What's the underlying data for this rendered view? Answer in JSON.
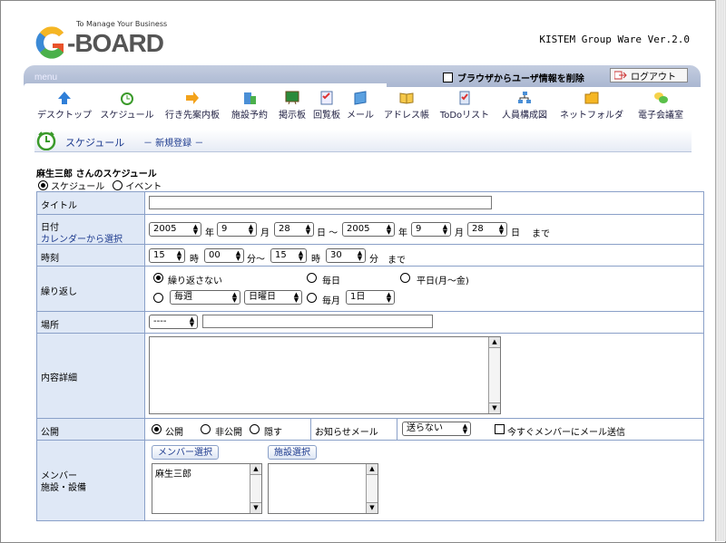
{
  "header": {
    "tagline": "To Manage Your Business",
    "logo_word": "BOARD",
    "version": "KISTEM Group Ware Ver.2.0"
  },
  "menu": {
    "label": "menu",
    "clear_browser_label": "ブラウザからユーザ情報を削除",
    "logout_label": "ログアウト",
    "items": [
      {
        "label": "デスクトップ",
        "icon": "arrow-up-icon"
      },
      {
        "label": "スケジュール",
        "icon": "clock-icon"
      },
      {
        "label": "行き先案内板",
        "icon": "arrow-right-icon"
      },
      {
        "label": "施設予約",
        "icon": "building-icon"
      },
      {
        "label": "掲示板",
        "icon": "board-icon"
      },
      {
        "label": "回覧板",
        "icon": "checklist-icon"
      },
      {
        "label": "メール",
        "icon": "mail-icon"
      },
      {
        "label": "アドレス帳",
        "icon": "book-icon"
      },
      {
        "label": "ToDoリスト",
        "icon": "todo-icon"
      },
      {
        "label": "人員構成図",
        "icon": "org-icon"
      },
      {
        "label": "ネットフォルダ",
        "icon": "folder-icon"
      },
      {
        "label": "電子会議室",
        "icon": "meeting-icon"
      }
    ]
  },
  "page": {
    "title": "スケジュール",
    "subtitle": "－ 新規登録 －",
    "owner": "麻生三郎 さんのスケジュール",
    "mode_schedule": "スケジュール",
    "mode_event": "イベント"
  },
  "form": {
    "title_label": "タイトル",
    "title_value": "",
    "date_label": "日付",
    "calendar_link": "カレンダーから選択",
    "start_year": "2005",
    "start_month": "9",
    "start_day": "28",
    "end_year": "2005",
    "end_month": "9",
    "end_day": "28",
    "unit_year": "年",
    "unit_month": "月",
    "unit_day": "日",
    "tilde": "日 ～",
    "until": "まで",
    "time_label": "時刻",
    "start_hour": "15",
    "start_min": "00",
    "end_hour": "15",
    "end_min": "30",
    "unit_hour": "時",
    "unit_min_tilde": "分～",
    "unit_min": "分",
    "repeat_label": "繰り返し",
    "repeat_none": "繰り返さない",
    "repeat_daily": "毎日",
    "repeat_weekdays": "平日(月～金)",
    "repeat_week_select": "毎週",
    "repeat_weekday_select": "日曜日",
    "repeat_monthly": "毎月",
    "repeat_monthday_select": "1日",
    "place_label": "場所",
    "place_select": "----",
    "place_value": "",
    "detail_label": "内容詳細",
    "publish_label": "公開",
    "publish_open": "公開",
    "publish_private": "非公開",
    "publish_hidden": "隠す",
    "notify_label": "お知らせメール",
    "notify_select": "送らない",
    "notify_now": "今すぐメンバーにメール送信",
    "member_label_1": "メンバー",
    "member_label_2": "施設・設備",
    "member_select_btn": "メンバー選択",
    "facility_select_btn": "施設選択",
    "members": [
      "麻生三郎"
    ]
  }
}
